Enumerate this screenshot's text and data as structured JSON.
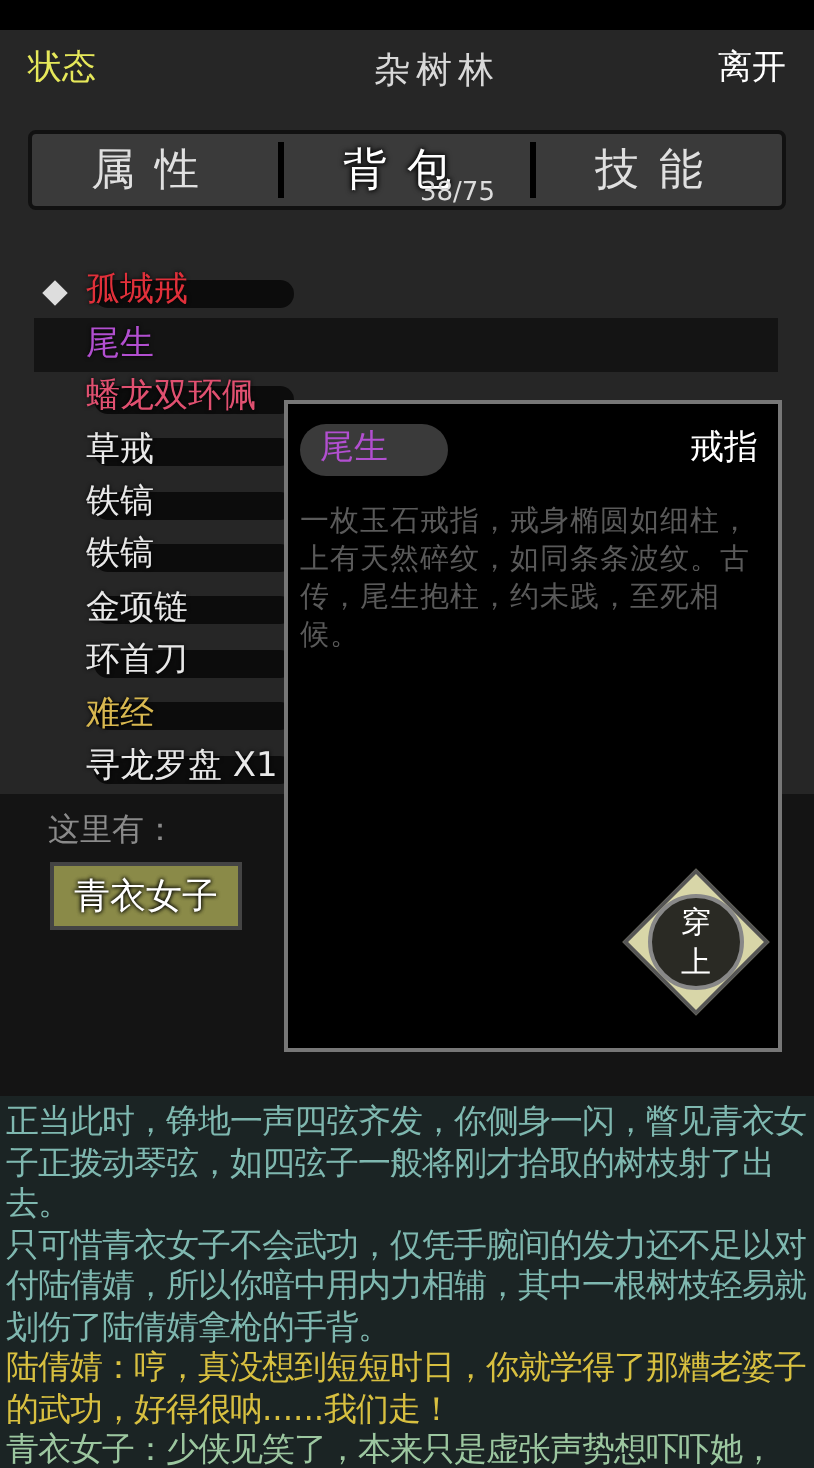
{
  "header": {
    "status": "状态",
    "title": "杂树林",
    "leave": "离开"
  },
  "tabs": [
    {
      "label": "属性",
      "selected": false
    },
    {
      "label": "背包",
      "selected": true,
      "badge": "38/75"
    },
    {
      "label": "技能",
      "selected": false
    }
  ],
  "items": [
    {
      "name": "孤城戒",
      "color": "#e0303a",
      "equipped": true,
      "selected": false
    },
    {
      "name": "尾生",
      "color": "#b24fd0",
      "equipped": false,
      "selected": true
    },
    {
      "name": "蟠龙双环佩",
      "color": "#e05070",
      "equipped": false,
      "selected": false
    },
    {
      "name": "草戒",
      "color": "#e8e8e8",
      "equipped": false,
      "selected": false
    },
    {
      "name": "铁镐",
      "color": "#e8e8e8",
      "equipped": false,
      "selected": false
    },
    {
      "name": "铁镐",
      "color": "#e8e8e8",
      "equipped": false,
      "selected": false
    },
    {
      "name": "金项链",
      "color": "#e8e8e8",
      "equipped": false,
      "selected": false
    },
    {
      "name": "环首刀",
      "color": "#e8e8e8",
      "equipped": false,
      "selected": false
    },
    {
      "name": "难经",
      "color": "#d8b850",
      "equipped": false,
      "selected": false
    },
    {
      "name": "寻龙罗盘 X1",
      "color": "#e8e8e8",
      "equipped": false,
      "selected": false
    }
  ],
  "detail": {
    "name": "尾生",
    "type": "戒指",
    "description": "一枚玉石戒指，戒身椭圆如细柱，上有天然碎纹，如同条条波纹。古传，尾生抱柱，约未践，至死相候。",
    "action": "穿上"
  },
  "here": {
    "label": "这里有：",
    "npcs": [
      "青衣女子"
    ]
  },
  "log": [
    {
      "kind": "narration",
      "text": "正当此时，铮地一声四弦齐发，你侧身一闪，瞥见青衣女子正拨动琴弦，如四弦子一般将刚才拾取的树枝射了出去。"
    },
    {
      "kind": "narration",
      "text": "只可惜青衣女子不会武功，仅凭手腕间的发力还不足以对付陆倩婧，所以你暗中用内力相辅，其中一根树枝轻易就划伤了陆倩婧拿枪的手背。"
    },
    {
      "kind": "dialogue",
      "text": "陆倩婧：哼，真没想到短短时日，你就学得了那糟老婆子的武功，好得很呐......我们走！"
    },
    {
      "kind": "reply",
      "text": "青衣女子：少侠见笑了，本来只是虚张声势想吓吓她，"
    }
  ]
}
